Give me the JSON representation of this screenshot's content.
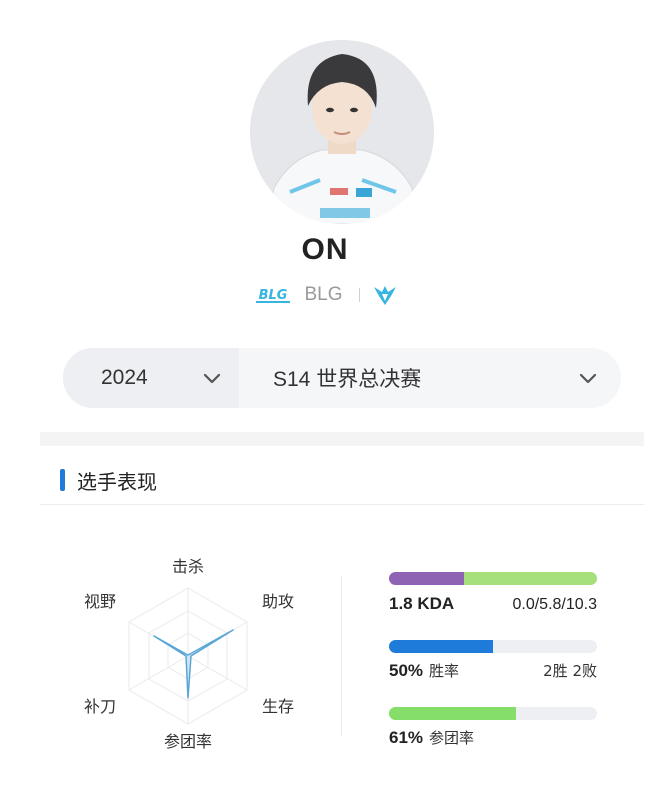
{
  "player": {
    "name": "ON",
    "team_abbr": "BLG"
  },
  "filters": {
    "year": "2024",
    "event": "S14 世界总决赛"
  },
  "section": {
    "title": "选手表现"
  },
  "radar": {
    "labels": {
      "kills": "击杀",
      "assists": "助攻",
      "survival": "生存",
      "teamfight": "参团率",
      "cs": "补刀",
      "vision": "视野"
    }
  },
  "stats": {
    "kda": {
      "value": "1.8 KDA",
      "detail": "0.0/5.8/10.3"
    },
    "winrate": {
      "value": "50%",
      "label": "胜率",
      "record": "2胜 2败",
      "fraction": 0.5
    },
    "teamfight": {
      "value": "61%",
      "label": "参团率",
      "fraction": 0.61
    }
  },
  "colors": {
    "accent": "#1f7bd9",
    "kda_purple": "#8e63b3",
    "kda_green": "#a6e07a",
    "winrate_blue": "#1f7bd9",
    "teamfight_green": "#86de6a",
    "team_logo_cyan": "#35b5e0"
  }
}
